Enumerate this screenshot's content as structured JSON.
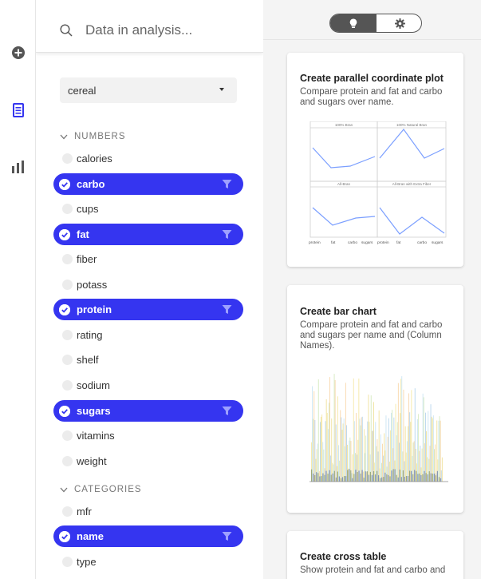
{
  "rail": {
    "icons": [
      "add-circle-icon",
      "document-list-icon",
      "bar-chart-icon"
    ],
    "accent": "#3535f0",
    "muted": "#555555"
  },
  "search": {
    "placeholder": "Data in analysis..."
  },
  "dataset": {
    "selected": "cereal"
  },
  "sections": {
    "numbers": "NUMBERS",
    "categories": "CATEGORIES"
  },
  "fields": {
    "calories": "calories",
    "carbo": "carbo",
    "cups": "cups",
    "fat": "fat",
    "fiber": "fiber",
    "potass": "potass",
    "protein": "protein",
    "rating": "rating",
    "shelf": "shelf",
    "sodium": "sodium",
    "sugars": "sugars",
    "vitamins": "vitamins",
    "weight": "weight",
    "mfr": "mfr",
    "name": "name",
    "type": "type"
  },
  "toggle": {
    "active": "lightbulb-icon",
    "inactive": "gear-icon"
  },
  "cards": [
    {
      "title": "Create parallel coordinate plot",
      "description": "Compare protein and fat and carbo and sugars over name.",
      "panels": [
        "100% Bran",
        "100% Natural Bran",
        "All-Bran",
        "All-Bran with Extra Fiber"
      ],
      "axis_labels": [
        "protein",
        "fat",
        "carbo",
        "sugars",
        "protein",
        "fat",
        "carbo",
        "sugars"
      ]
    },
    {
      "title": "Create bar chart",
      "description": "Compare protein and fat and carbo and sugars per name and (Column Names)."
    },
    {
      "title": "Create cross table",
      "description": "Show protein and fat and carbo and"
    }
  ]
}
